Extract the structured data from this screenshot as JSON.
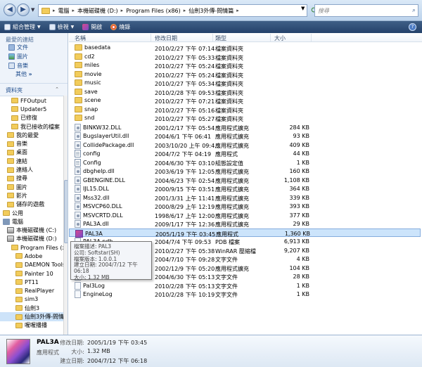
{
  "address": {
    "path": [
      "電腦",
      "本機磁碟機 (D:)",
      "Program Files (x86)",
      "仙劍3外傳-問情篇"
    ],
    "search_placeholder": "搜尋"
  },
  "toolbar": {
    "organize": "組合管理",
    "views": "檢視",
    "open": "開啟",
    "burn": "燒錄"
  },
  "left": {
    "favorites_heading": "最愛的連結",
    "favorites": [
      "文件",
      "圖片",
      "音樂"
    ],
    "more": "其他",
    "folders_heading": "資料夾",
    "tree": [
      {
        "label": "FFOutput",
        "indent": 2,
        "icon": "folder"
      },
      {
        "label": "Updater5",
        "indent": 2,
        "icon": "folder"
      },
      {
        "label": "已修復",
        "indent": 2,
        "icon": "folder"
      },
      {
        "label": "我已接收的檔案",
        "indent": 2,
        "icon": "folder"
      },
      {
        "label": "我的最愛",
        "indent": 1,
        "icon": "folder"
      },
      {
        "label": "音樂",
        "indent": 1,
        "icon": "folder"
      },
      {
        "label": "桌面",
        "indent": 1,
        "icon": "folder"
      },
      {
        "label": "連結",
        "indent": 1,
        "icon": "folder"
      },
      {
        "label": "連絡人",
        "indent": 1,
        "icon": "folder"
      },
      {
        "label": "搜尋",
        "indent": 1,
        "icon": "folder"
      },
      {
        "label": "圖片",
        "indent": 1,
        "icon": "folder"
      },
      {
        "label": "影片",
        "indent": 1,
        "icon": "folder"
      },
      {
        "label": "儲存的遊戲",
        "indent": 1,
        "icon": "folder"
      },
      {
        "label": "公用",
        "indent": 0,
        "icon": "folder"
      },
      {
        "label": "電腦",
        "indent": 0,
        "icon": "computer"
      },
      {
        "label": "本機磁碟機 (C:)",
        "indent": 1,
        "icon": "drive"
      },
      {
        "label": "本機磁碟機 (D:)",
        "indent": 1,
        "icon": "drive"
      },
      {
        "label": "Program Files (x86)",
        "indent": 2,
        "icon": "folder"
      },
      {
        "label": "Adobe",
        "indent": 3,
        "icon": "folder"
      },
      {
        "label": "DAEMON Tools",
        "indent": 3,
        "icon": "folder"
      },
      {
        "label": "Painter 10",
        "indent": 3,
        "icon": "folder"
      },
      {
        "label": "PT11",
        "indent": 3,
        "icon": "folder"
      },
      {
        "label": "RealPlayer",
        "indent": 3,
        "icon": "folder"
      },
      {
        "label": "sim3",
        "indent": 3,
        "icon": "folder"
      },
      {
        "label": "仙劍3",
        "indent": 3,
        "icon": "folder"
      },
      {
        "label": "仙劍3外傳-問情篇",
        "indent": 3,
        "icon": "folder",
        "selected": true
      },
      {
        "label": "喔喔播播",
        "indent": 3,
        "icon": "folder"
      }
    ]
  },
  "columns": {
    "name": "名稱",
    "date": "修改日期",
    "type": "類型",
    "size": "大小"
  },
  "files": [
    {
      "name": "basedata",
      "date": "2010/2/27 下午 07:14",
      "type": "檔案資料夾",
      "size": "",
      "icon": "folder"
    },
    {
      "name": "cd2",
      "date": "2010/2/27 下午 05:33",
      "type": "檔案資料夾",
      "size": "",
      "icon": "folder"
    },
    {
      "name": "miles",
      "date": "2010/2/27 下午 05:24",
      "type": "檔案資料夾",
      "size": "",
      "icon": "folder"
    },
    {
      "name": "movie",
      "date": "2010/2/27 下午 05:24",
      "type": "檔案資料夾",
      "size": "",
      "icon": "folder"
    },
    {
      "name": "music",
      "date": "2010/2/27 下午 05:34",
      "type": "檔案資料夾",
      "size": "",
      "icon": "folder"
    },
    {
      "name": "save",
      "date": "2010/2/28 下午 09:53",
      "type": "檔案資料夾",
      "size": "",
      "icon": "folder"
    },
    {
      "name": "scene",
      "date": "2010/2/27 下午 07:21",
      "type": "檔案資料夾",
      "size": "",
      "icon": "folder"
    },
    {
      "name": "snap",
      "date": "2010/2/27 下午 05:16",
      "type": "檔案資料夾",
      "size": "",
      "icon": "folder"
    },
    {
      "name": "snd",
      "date": "2010/2/27 下午 05:27",
      "type": "檔案資料夾",
      "size": "",
      "icon": "folder"
    },
    {
      "name": "BINKW32.DLL",
      "date": "2001/2/17 下午 05:54",
      "type": "應用程式擴充",
      "size": "284 KB",
      "icon": "dll"
    },
    {
      "name": "BugslayerUtil.dll",
      "date": "2004/6/1 下午 06:41",
      "type": "應用程式擴充",
      "size": "93 KB",
      "icon": "dll"
    },
    {
      "name": "CollidePackage.dll",
      "date": "2003/10/20 上午 09:4...",
      "type": "應用程式擴充",
      "size": "409 KB",
      "icon": "dll"
    },
    {
      "name": "config",
      "date": "2004/7/2 下午 04:19",
      "type": "應用程式",
      "size": "44 KB",
      "icon": "cfg"
    },
    {
      "name": "Config",
      "date": "2004/6/30 下午 03:10",
      "type": "組態設定值",
      "size": "1 KB",
      "icon": "cfg"
    },
    {
      "name": "dbghelp.dll",
      "date": "2003/6/19 下午 12:05",
      "type": "應用程式擴充",
      "size": "160 KB",
      "icon": "dll"
    },
    {
      "name": "GBENGINE.DLL",
      "date": "2004/6/23 下午 02:54",
      "type": "應用程式擴充",
      "size": "1,108 KB",
      "icon": "dll"
    },
    {
      "name": "IJL15.DLL",
      "date": "2000/9/15 下午 03:51",
      "type": "應用程式擴充",
      "size": "364 KB",
      "icon": "dll"
    },
    {
      "name": "Mss32.dll",
      "date": "2001/3/31 上午 11:41",
      "type": "應用程式擴充",
      "size": "339 KB",
      "icon": "dll"
    },
    {
      "name": "MSVCP60.DLL",
      "date": "2000/8/29 上午 12:19",
      "type": "應用程式擴充",
      "size": "393 KB",
      "icon": "dll"
    },
    {
      "name": "MSVCRTD.DLL",
      "date": "1998/6/17 上午 12:00",
      "type": "應用程式擴充",
      "size": "377 KB",
      "icon": "dll"
    },
    {
      "name": "PAL3A.dll",
      "date": "2009/1/17 下午 12:36",
      "type": "應用程式擴充",
      "size": "29 KB",
      "icon": "dll"
    },
    {
      "name": "PAL3A",
      "date": "2005/1/19 下午 03:45",
      "type": "應用程式",
      "size": "1,360 KB",
      "icon": "exe",
      "selected": true
    },
    {
      "name": "PAL3A.pdb",
      "date": "2004/7/4 下午 09:53",
      "type": "PDB 檔案",
      "size": "6,913 KB",
      "icon": "file"
    },
    {
      "name": "pal3a",
      "date": "2010/2/27 下午 05:38",
      "type": "WinRAR 壓縮檔",
      "size": "9,207 KB",
      "icon": "file"
    },
    {
      "name": "Pal3Alog",
      "date": "2004/7/10 下午 09:28",
      "type": "文字文件",
      "size": "4 KB",
      "icon": "file"
    },
    {
      "name": "pal3alog",
      "date": "2002/12/9 下午 05:20",
      "type": "應用程式擴充",
      "size": "104 KB",
      "icon": "file"
    },
    {
      "name": "Pal3ALog",
      "date": "2004/6/30 下午 05:13",
      "type": "文字文件",
      "size": "28 KB",
      "icon": "file"
    },
    {
      "name": "Pal3Log",
      "date": "2010/2/28 下午 05:13",
      "type": "文字文件",
      "size": "1 KB",
      "icon": "file"
    },
    {
      "name": "EngineLog",
      "date": "2010/2/28 下午 10:19",
      "type": "文字文件",
      "size": "1 KB",
      "icon": "file"
    }
  ],
  "tooltip": {
    "lines": [
      "檔案描述: PAL3",
      "公司: Softstar(SH)",
      "檔案版本: 1.0.0.1",
      "建立日期: 2004/7/12 下午 06:18",
      "大小: 1.32 MB"
    ]
  },
  "details": {
    "name": "PAL3A",
    "type": "應用程式",
    "modified_label": "修改日期:",
    "modified": "2005/1/19 下午 03:45",
    "size_label": "大小:",
    "size": "1.32 MB",
    "created_label": "建立日期:",
    "created": "2004/7/12 下午 06:18"
  }
}
